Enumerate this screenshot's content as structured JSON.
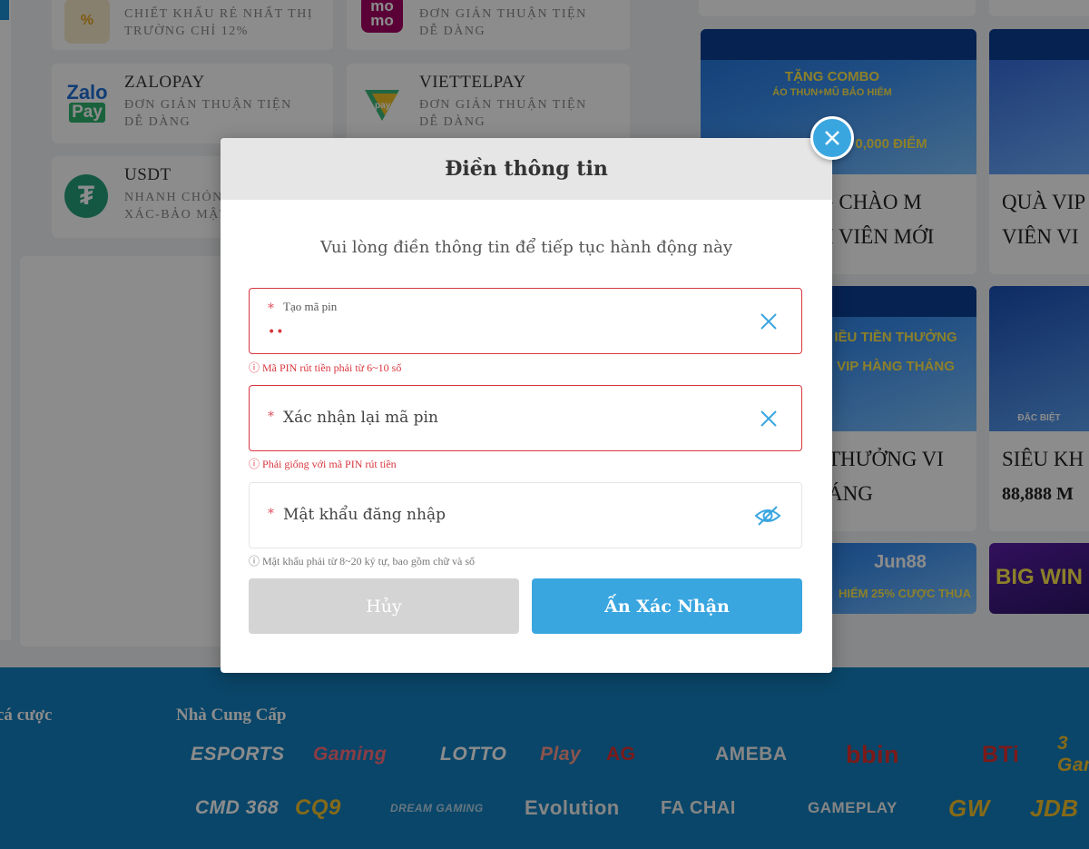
{
  "payment_methods": [
    {
      "name": "",
      "desc": [
        "CHIẾT KHẤU RẺ NHẤT THỊ",
        "TRƯỜNG CHỈ 12%"
      ],
      "icon": "discount-icon"
    },
    {
      "name": "",
      "desc": [
        "ĐƠN GIẢN THUẬN TIỆN",
        "DỄ DÀNG"
      ],
      "icon": "momo-icon",
      "icon_text": "mo\nmo"
    },
    {
      "name": "ZALOPAY",
      "desc": [
        "ĐƠN GIẢN THUẬN TIỆN",
        "DỄ DÀNG"
      ],
      "icon": "zalopay-icon",
      "icon_text": "Zalo\nPay"
    },
    {
      "name": "VIETTELPAY",
      "desc": [
        "ĐƠN GIẢN THUẬN TIỆN",
        "DỄ DÀNG"
      ],
      "icon": "viettelpay-icon",
      "icon_text": "pay"
    },
    {
      "name": "USDT",
      "desc": [
        "NHANH CHÓNG",
        "XÁC-BẢO MẬT"
      ],
      "icon": "tether-icon",
      "icon_text": "₮"
    }
  ],
  "promos": [
    {
      "title": [
        "G CHÀO M",
        "H VIÊN MỚI"
      ],
      "banner": [
        "TẶNG COMBO",
        "ÁO THUN+MŨ BẢO HIỂM",
        "0,000 ĐIỂM"
      ]
    },
    {
      "title": [
        "QUÀ VIP",
        "VIÊN VI"
      ],
      "banner": []
    },
    {
      "title": [
        "THƯỞNG VI",
        "ÁNG"
      ],
      "banner": [
        "IỀU TIỀN THƯỞNG",
        "VIP HÀNG THÁNG"
      ]
    },
    {
      "title": [
        "SIÊU KH",
        "88,888 M"
      ],
      "banner": [
        "ĐẶC BIỆT"
      ]
    },
    {
      "title": [],
      "banner": [
        "Jun88",
        "HIỂM 25% CƯỢC THUA"
      ]
    },
    {
      "title": [],
      "banner": [
        "BIG WIN"
      ]
    }
  ],
  "footer": {
    "left_label": "cá cược",
    "providers_label": "Nhà Cung Cấp",
    "providers_row1": [
      "ESPORTS",
      "Gaming",
      "LOTTO",
      "Play",
      "AG",
      "AMEBA",
      "bbin",
      "BTi",
      "3 Gam"
    ],
    "providers_row2": [
      "CMD 368",
      "CQ9",
      "DREAM GAMING",
      "Evolution",
      "FA CHAI",
      "GAMEPLAY",
      "GW",
      "JDB"
    ]
  },
  "modal": {
    "title": "Điền thông tin",
    "subtitle": "Vui lòng điền thông tin để tiếp tục hành động này",
    "pin_field": {
      "label": "Tạo mã pin",
      "value": "••",
      "hint": "Mã PIN rút tiền phải từ 6~10 số"
    },
    "confirm_pin_field": {
      "label": "Xác nhận lại mã pin",
      "hint": "Phải giống với mã PIN rút tiền"
    },
    "password_field": {
      "label": "Mật khẩu đăng nhập",
      "hint": "Mật khẩu phải từ 8~20 ký tự, bao gồm chữ và số"
    },
    "required_mark": "*",
    "cancel_label": "Hủy",
    "confirm_label": "Ấn Xác Nhận"
  },
  "colors": {
    "accent": "#3aa6e0",
    "error": "#d9363e",
    "footer": "#1380bf"
  }
}
